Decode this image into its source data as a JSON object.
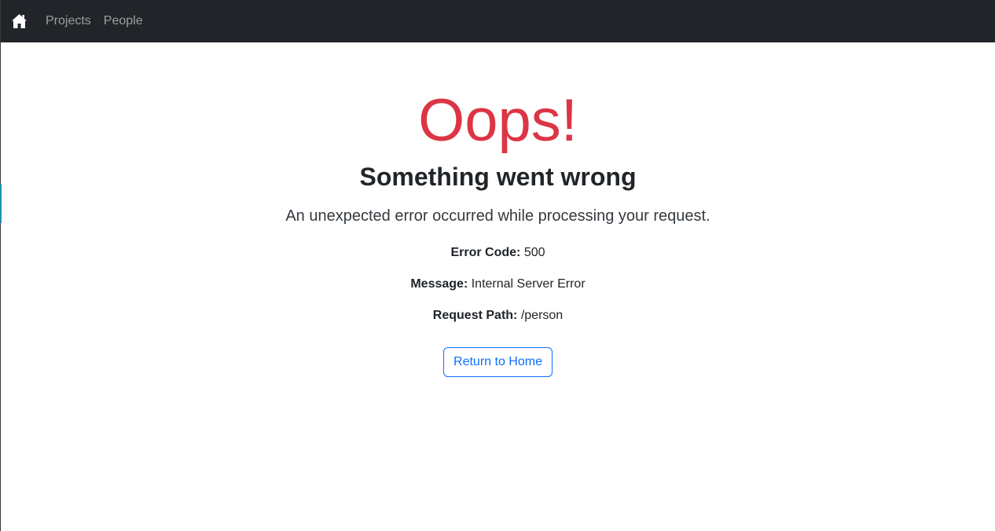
{
  "navbar": {
    "home_icon": "house-icon",
    "links": [
      "Projects",
      "People"
    ]
  },
  "error": {
    "title": "Oops!",
    "subtitle": "Something went wrong",
    "lead": "An unexpected error occurred while processing your request.",
    "details": [
      {
        "key": "Error Code:",
        "value": "500"
      },
      {
        "key": "Message:",
        "value": "Internal Server Error"
      },
      {
        "key": "Request Path:",
        "value": "/person"
      }
    ],
    "button_label": "Return to Home"
  },
  "colors": {
    "navbar_bg": "#212529",
    "title": "#dc3545",
    "button": "#0d6efd"
  }
}
